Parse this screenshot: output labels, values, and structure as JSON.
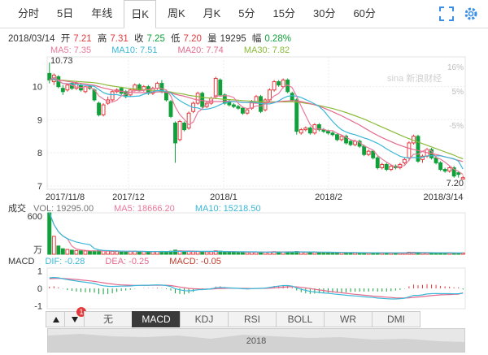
{
  "tabs": [
    {
      "label": "分时",
      "active": false
    },
    {
      "label": "5日",
      "active": false
    },
    {
      "label": "年线",
      "active": false
    },
    {
      "label": "日K",
      "active": true
    },
    {
      "label": "周K",
      "active": false
    },
    {
      "label": "月K",
      "active": false
    },
    {
      "label": "5分",
      "active": false
    },
    {
      "label": "15分",
      "active": false
    },
    {
      "label": "30分",
      "active": false
    },
    {
      "label": "60分",
      "active": false
    }
  ],
  "icons": [
    "fullscreen-icon",
    "settings-icon"
  ],
  "info": {
    "date": "2018/03/14",
    "open_label": "开",
    "open": "7.21",
    "high_label": "高",
    "high": "7.31",
    "close_label": "收",
    "close": "7.25",
    "low_label": "低",
    "low": "7.20",
    "vol_label": "量",
    "vol": "19295",
    "amp_label": "幅",
    "amp": "0.28%"
  },
  "ma_legend": [
    {
      "label": "MA5: 7.35",
      "color": "#e9799b"
    },
    {
      "label": "MA10: 7.51",
      "color": "#3ab7d8"
    },
    {
      "label": "MA20: 7.74",
      "color": "#e36a8d"
    },
    {
      "label": "MA30: 7.82",
      "color": "#8bbb3a"
    }
  ],
  "price_axis": {
    "ticks": [
      "10",
      "9",
      "8",
      "7"
    ],
    "pct_ticks": [
      "16%",
      "5%",
      "-5%"
    ],
    "max_label": "10.73",
    "last_label": "7.20"
  },
  "date_axis": [
    "2017/11/8",
    "2017/12",
    "2018/1",
    "2018/2",
    "2018/3/14"
  ],
  "watermark": "新浪财经",
  "volume": {
    "title": "成交",
    "legend": [
      {
        "label": "VOL: 19295.00",
        "color": "#777"
      },
      {
        "label": "MA5: 18666.20",
        "color": "#e9799b"
      },
      {
        "label": "MA10: 15218.50",
        "color": "#3ab7d8"
      }
    ],
    "top_tick": "600",
    "unit": "万"
  },
  "macd": {
    "legend": [
      {
        "label": "MACD",
        "color": "#333"
      },
      {
        "label": "DIF: -0.28",
        "color": "#3ab7d8"
      },
      {
        "label": "DEA: -0.25",
        "color": "#e36a8d"
      },
      {
        "label": "MACD: -0.05",
        "color": "#c0392b"
      }
    ],
    "ticks": [
      "1",
      "0",
      "-1"
    ]
  },
  "indicator_tabs": [
    {
      "label": "无",
      "active": false
    },
    {
      "label": "MACD",
      "active": true
    },
    {
      "label": "KDJ",
      "active": false
    },
    {
      "label": "RSI",
      "active": false
    },
    {
      "label": "BOLL",
      "active": false
    },
    {
      "label": "WR",
      "active": false
    },
    {
      "label": "DMI",
      "active": false
    }
  ],
  "badge": "1",
  "scroller_label": "2018",
  "colors": {
    "up": "#e4393c",
    "down": "#11a03b",
    "ma5": "#e9799b",
    "ma10": "#3ab7d8",
    "ma20": "#e36a8d",
    "ma30": "#8bbb3a"
  },
  "chart_data": {
    "type": "candlestick",
    "ylim": [
      6.9,
      10.9
    ],
    "close": [
      10.2,
      10.35,
      10.0,
      9.85,
      10.05,
      9.95,
      10.1,
      9.9,
      10.0,
      9.95,
      9.6,
      9.15,
      9.45,
      9.6,
      9.85,
      9.9,
      9.8,
      9.7,
      9.9,
      10.05,
      9.9,
      10.0,
      9.8,
      9.95,
      10.1,
      9.85,
      9.6,
      9.1,
      8.3,
      8.95,
      8.7,
      9.2,
      9.5,
      9.8,
      9.4,
      9.5,
      9.65,
      10.25,
      9.75,
      9.5,
      9.45,
      9.4,
      9.35,
      9.2,
      9.3,
      9.55,
      9.7,
      9.25,
      9.6,
      9.9,
      10.15,
      10.05,
      10.2,
      9.85,
      9.6,
      8.65,
      8.7,
      8.75,
      8.6,
      8.85,
      8.7,
      8.65,
      8.6,
      8.55,
      8.4,
      8.5,
      8.3,
      8.25,
      8.35,
      8.2,
      7.95,
      8.05,
      7.85,
      7.55,
      7.65,
      7.5,
      7.6,
      7.55,
      7.65,
      7.8,
      8.3,
      8.5,
      7.75,
      7.9,
      8.1,
      7.85,
      7.7,
      7.5,
      7.45,
      7.55,
      7.3,
      7.35,
      7.25
    ],
    "open": [
      10.4,
      10.15,
      10.3,
      9.95,
      9.9,
      10.1,
      9.95,
      10.05,
      9.85,
      10.0,
      9.9,
      9.5,
      9.15,
      9.5,
      9.6,
      9.85,
      9.95,
      9.85,
      9.75,
      9.9,
      10.05,
      9.9,
      10.0,
      9.8,
      9.95,
      10.1,
      9.85,
      9.55,
      8.9,
      8.4,
      8.9,
      8.75,
      9.25,
      9.5,
      9.8,
      9.4,
      9.5,
      9.7,
      10.2,
      9.75,
      9.55,
      9.45,
      9.4,
      9.35,
      9.2,
      9.35,
      9.55,
      9.7,
      9.3,
      9.6,
      9.9,
      10.15,
      10.0,
      10.2,
      9.8,
      9.6,
      8.6,
      8.7,
      8.75,
      8.6,
      8.85,
      8.7,
      8.65,
      8.6,
      8.55,
      8.4,
      8.5,
      8.35,
      8.25,
      8.35,
      8.2,
      7.95,
      8.05,
      7.85,
      7.55,
      7.65,
      7.5,
      7.6,
      7.55,
      7.7,
      7.85,
      8.3,
      8.5,
      7.8,
      7.9,
      8.1,
      7.85,
      7.7,
      7.5,
      7.45,
      7.55,
      7.4,
      7.21
    ],
    "high": [
      10.73,
      10.4,
      10.35,
      10.05,
      10.1,
      10.15,
      10.15,
      10.1,
      10.05,
      10.05,
      9.95,
      9.55,
      9.5,
      9.7,
      9.9,
      9.95,
      10.0,
      9.9,
      9.95,
      10.1,
      10.1,
      10.05,
      10.05,
      10.0,
      10.15,
      10.2,
      9.9,
      9.6,
      8.95,
      9.0,
      8.95,
      9.25,
      9.55,
      9.85,
      9.85,
      9.55,
      9.7,
      10.3,
      10.25,
      9.8,
      9.6,
      9.5,
      9.45,
      9.4,
      9.35,
      9.6,
      9.75,
      9.75,
      9.65,
      9.95,
      10.2,
      10.2,
      10.25,
      10.25,
      9.85,
      9.65,
      8.75,
      8.8,
      8.8,
      8.9,
      8.9,
      8.75,
      8.7,
      8.65,
      8.6,
      8.55,
      8.55,
      8.4,
      8.4,
      8.4,
      8.25,
      8.1,
      8.1,
      7.9,
      7.7,
      7.7,
      7.65,
      7.65,
      7.7,
      7.85,
      8.35,
      8.55,
      8.55,
      7.95,
      8.15,
      8.15,
      7.9,
      7.75,
      7.55,
      7.6,
      7.6,
      7.45,
      7.31
    ],
    "low": [
      10.1,
      10.05,
      9.95,
      9.75,
      9.85,
      9.9,
      9.9,
      9.85,
      9.8,
      9.9,
      9.55,
      9.1,
      9.1,
      9.45,
      9.55,
      9.8,
      9.75,
      9.65,
      9.7,
      9.85,
      9.85,
      9.85,
      9.75,
      9.75,
      9.9,
      9.8,
      9.55,
      9.05,
      7.7,
      8.35,
      8.65,
      8.7,
      9.2,
      9.45,
      9.35,
      9.35,
      9.45,
      9.65,
      9.7,
      9.45,
      9.4,
      9.35,
      9.3,
      9.15,
      9.15,
      9.3,
      9.5,
      9.2,
      9.25,
      9.55,
      9.85,
      10.0,
      9.95,
      9.8,
      9.55,
      8.55,
      8.55,
      8.65,
      8.55,
      8.55,
      8.65,
      8.6,
      8.55,
      8.5,
      8.35,
      8.35,
      8.25,
      8.2,
      8.2,
      8.15,
      7.9,
      7.9,
      7.8,
      7.5,
      7.5,
      7.45,
      7.45,
      7.5,
      7.5,
      7.65,
      7.75,
      8.25,
      7.7,
      7.7,
      7.85,
      7.8,
      7.65,
      7.45,
      7.4,
      7.4,
      7.25,
      7.25,
      7.2
    ],
    "vol": [
      600,
      260,
      120,
      80,
      70,
      60,
      55,
      50,
      48,
      45,
      50,
      55,
      48,
      45,
      42,
      40,
      38,
      40,
      42,
      44,
      40,
      38,
      36,
      35,
      40,
      42,
      38,
      45,
      60,
      50,
      42,
      40,
      38,
      40,
      36,
      34,
      35,
      50,
      45,
      38,
      34,
      32,
      30,
      30,
      28,
      30,
      32,
      30,
      30,
      34,
      38,
      36,
      34,
      34,
      32,
      40,
      34,
      30,
      28,
      28,
      26,
      26,
      25,
      24,
      24,
      24,
      23,
      22,
      22,
      22,
      21,
      21,
      20,
      22,
      20,
      20,
      19,
      19,
      20,
      22,
      30,
      28,
      26,
      22,
      22,
      20,
      19,
      18,
      18,
      18,
      18,
      17,
      19
    ],
    "ma5": [
      10.2,
      10.28,
      10.18,
      10.1,
      10.09,
      10.04,
      9.99,
      9.97,
      10.0,
      9.98,
      9.91,
      9.72,
      9.63,
      9.55,
      9.53,
      9.59,
      9.72,
      9.77,
      9.83,
      9.89,
      9.87,
      9.89,
      9.91,
      9.94,
      9.95,
      9.94,
      9.9,
      9.72,
      9.39,
      9.16,
      9.01,
      8.85,
      8.93,
      9.23,
      9.33,
      9.48,
      9.57,
      9.74,
      9.71,
      9.73,
      9.72,
      9.67,
      9.5,
      9.38,
      9.34,
      9.36,
      9.42,
      9.41,
      9.48,
      9.6,
      9.72,
      9.79,
      9.98,
      10.05,
      9.97,
      9.71,
      9.41,
      9.13,
      8.86,
      8.71,
      8.72,
      8.71,
      8.67,
      8.67,
      8.59,
      8.54,
      8.47,
      8.4,
      8.36,
      8.32,
      8.21,
      8.15,
      8.08,
      7.92,
      7.81,
      7.72,
      7.64,
      7.57,
      7.59,
      7.62,
      7.78,
      7.96,
      7.96,
      8.05,
      8.11,
      8.06,
      7.86,
      7.81,
      7.72,
      7.61,
      7.51,
      7.44,
      7.35
    ],
    "ma10": [
      10.2,
      10.25,
      10.17,
      10.1,
      10.09,
      10.08,
      10.07,
      10.05,
      10.04,
      10.03,
      10.01,
      9.91,
      9.82,
      9.77,
      9.76,
      9.76,
      9.73,
      9.71,
      9.7,
      9.71,
      9.72,
      9.77,
      9.81,
      9.85,
      9.88,
      9.88,
      9.86,
      9.81,
      9.68,
      9.58,
      9.5,
      9.43,
      9.37,
      9.36,
      9.31,
      9.32,
      9.35,
      9.39,
      9.46,
      9.51,
      9.54,
      9.55,
      9.54,
      9.52,
      9.52,
      9.53,
      9.52,
      9.49,
      9.48,
      9.48,
      9.51,
      9.57,
      9.65,
      9.71,
      9.73,
      9.71,
      9.67,
      9.61,
      9.55,
      9.48,
      9.4,
      9.28,
      9.11,
      8.95,
      8.81,
      8.7,
      8.63,
      8.58,
      8.55,
      8.5,
      8.45,
      8.41,
      8.35,
      8.29,
      8.21,
      8.12,
      8.04,
      7.97,
      7.9,
      7.86,
      7.85,
      7.86,
      7.85,
      7.87,
      7.91,
      7.91,
      7.91,
      7.91,
      7.88,
      7.85,
      7.82,
      7.75,
      7.51
    ],
    "ma20": [
      10.2,
      10.22,
      10.2,
      10.18,
      10.16,
      10.14,
      10.12,
      10.1,
      10.08,
      10.06,
      10.04,
      10.0,
      9.96,
      9.93,
      9.9,
      9.88,
      9.86,
      9.84,
      9.83,
      9.82,
      9.82,
      9.82,
      9.82,
      9.83,
      9.84,
      9.84,
      9.83,
      9.81,
      9.77,
      9.74,
      9.71,
      9.67,
      9.63,
      9.6,
      9.58,
      9.56,
      9.55,
      9.55,
      9.55,
      9.56,
      9.56,
      9.55,
      9.54,
      9.53,
      9.52,
      9.51,
      9.5,
      9.5,
      9.51,
      9.52,
      9.53,
      9.54,
      9.56,
      9.57,
      9.58,
      9.57,
      9.55,
      9.52,
      9.49,
      9.45,
      9.41,
      9.36,
      9.3,
      9.24,
      9.18,
      9.12,
      9.05,
      8.98,
      8.91,
      8.84,
      8.76,
      8.68,
      8.6,
      8.53,
      8.46,
      8.4,
      8.34,
      8.28,
      8.23,
      8.18,
      8.14,
      8.1,
      8.07,
      8.04,
      8.01,
      7.98,
      7.95,
      7.92,
      7.88,
      7.85,
      7.81,
      7.77,
      7.74
    ],
    "ma30": [
      10.2,
      10.21,
      10.2,
      10.19,
      10.18,
      10.17,
      10.16,
      10.15,
      10.14,
      10.13,
      10.12,
      10.1,
      10.07,
      10.04,
      10.02,
      10.0,
      9.98,
      9.96,
      9.94,
      9.93,
      9.92,
      9.91,
      9.9,
      9.89,
      9.88,
      9.87,
      9.86,
      9.84,
      9.81,
      9.79,
      9.77,
      9.74,
      9.72,
      9.7,
      9.68,
      9.66,
      9.65,
      9.64,
      9.63,
      9.62,
      9.61,
      9.6,
      9.59,
      9.58,
      9.57,
      9.56,
      9.55,
      9.54,
      9.54,
      9.54,
      9.54,
      9.54,
      9.54,
      9.54,
      9.54,
      9.53,
      9.52,
      9.5,
      9.48,
      9.46,
      9.43,
      9.4,
      9.37,
      9.34,
      9.3,
      9.26,
      9.22,
      9.17,
      9.12,
      9.07,
      9.02,
      8.96,
      8.9,
      8.84,
      8.78,
      8.72,
      8.66,
      8.6,
      8.54,
      8.48,
      8.43,
      8.38,
      8.33,
      8.28,
      8.23,
      8.18,
      8.13,
      8.08,
      8.03,
      7.98,
      7.93,
      7.87,
      7.82
    ],
    "dif": [
      0.6,
      0.62,
      0.6,
      0.55,
      0.5,
      0.46,
      0.42,
      0.38,
      0.35,
      0.32,
      0.28,
      0.2,
      0.15,
      0.12,
      0.11,
      0.12,
      0.13,
      0.13,
      0.14,
      0.16,
      0.17,
      0.18,
      0.18,
      0.19,
      0.2,
      0.19,
      0.16,
      0.1,
      -0.02,
      -0.08,
      -0.13,
      -0.14,
      -0.12,
      -0.08,
      -0.07,
      -0.05,
      -0.03,
      0.03,
      0.05,
      0.04,
      0.03,
      0.02,
      0.0,
      -0.02,
      -0.03,
      -0.02,
      0.0,
      0.0,
      0.02,
      0.05,
      0.1,
      0.13,
      0.16,
      0.16,
      0.13,
      0.03,
      -0.05,
      -0.11,
      -0.17,
      -0.2,
      -0.23,
      -0.26,
      -0.28,
      -0.31,
      -0.34,
      -0.36,
      -0.39,
      -0.41,
      -0.43,
      -0.45,
      -0.48,
      -0.5,
      -0.52,
      -0.55,
      -0.57,
      -0.59,
      -0.6,
      -0.6,
      -0.59,
      -0.56,
      -0.48,
      -0.4,
      -0.4,
      -0.37,
      -0.32,
      -0.3,
      -0.29,
      -0.3,
      -0.3,
      -0.3,
      -0.31,
      -0.3,
      -0.28
    ],
    "dea": [
      0.55,
      0.56,
      0.57,
      0.56,
      0.55,
      0.53,
      0.51,
      0.48,
      0.46,
      0.43,
      0.4,
      0.36,
      0.32,
      0.28,
      0.25,
      0.22,
      0.2,
      0.19,
      0.18,
      0.17,
      0.17,
      0.17,
      0.17,
      0.18,
      0.18,
      0.18,
      0.18,
      0.16,
      0.12,
      0.08,
      0.04,
      0.0,
      -0.02,
      -0.03,
      -0.04,
      -0.04,
      -0.04,
      -0.02,
      -0.01,
      0.0,
      0.01,
      0.01,
      0.01,
      0.0,
      0.0,
      -0.01,
      -0.01,
      0.0,
      0.0,
      0.01,
      0.03,
      0.05,
      0.07,
      0.09,
      0.1,
      0.09,
      0.06,
      0.03,
      -0.01,
      -0.05,
      -0.09,
      -0.12,
      -0.16,
      -0.19,
      -0.22,
      -0.25,
      -0.28,
      -0.31,
      -0.34,
      -0.36,
      -0.39,
      -0.41,
      -0.44,
      -0.46,
      -0.48,
      -0.5,
      -0.52,
      -0.54,
      -0.55,
      -0.55,
      -0.54,
      -0.51,
      -0.49,
      -0.47,
      -0.44,
      -0.41,
      -0.39,
      -0.37,
      -0.36,
      -0.35,
      -0.34,
      -0.33,
      -0.25
    ]
  }
}
